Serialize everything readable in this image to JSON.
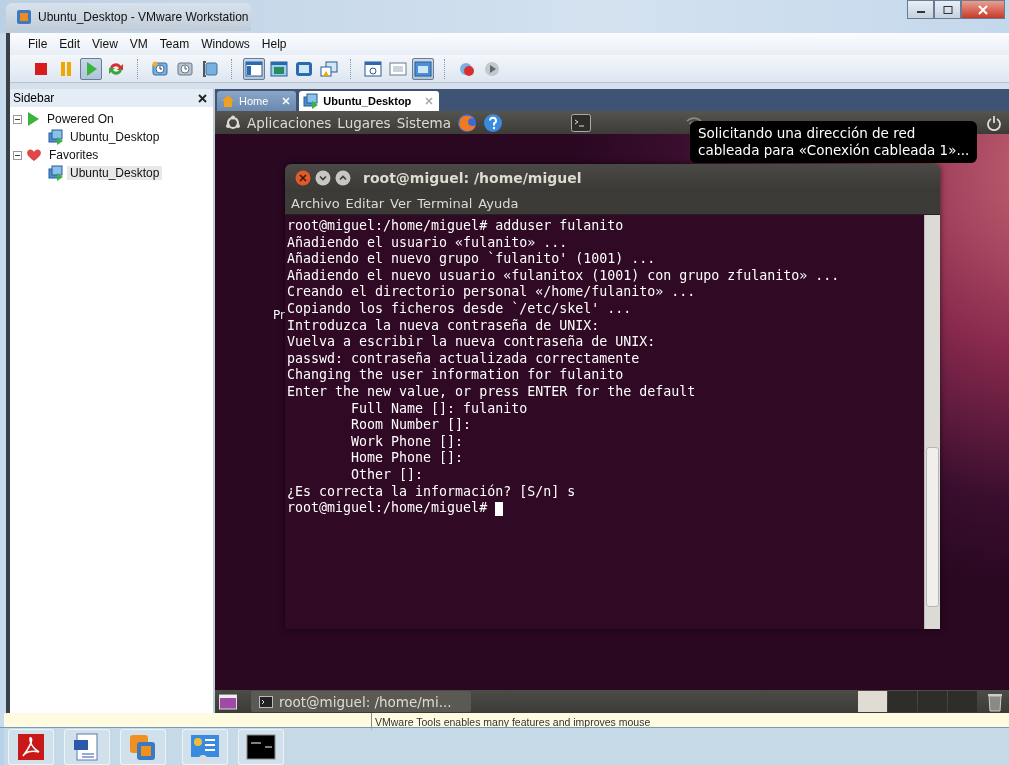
{
  "window": {
    "title": "Ubuntu_Desktop - VMware Workstation"
  },
  "menu": [
    "File",
    "Edit",
    "View",
    "VM",
    "Team",
    "Windows",
    "Help"
  ],
  "toolbar": [
    {
      "kind": "stop",
      "pressed": false
    },
    {
      "kind": "pause",
      "pressed": false
    },
    {
      "kind": "play",
      "pressed": true
    },
    {
      "kind": "reset",
      "pressed": false
    },
    {
      "kind": "separator"
    },
    {
      "kind": "snapshot",
      "pressed": false
    },
    {
      "kind": "revert",
      "pressed": false
    },
    {
      "kind": "manager",
      "pressed": false
    },
    {
      "kind": "separator"
    },
    {
      "kind": "sidebar",
      "pressed": true
    },
    {
      "kind": "fullscreen",
      "pressed": false
    },
    {
      "kind": "quickswitch",
      "pressed": false
    },
    {
      "kind": "unity",
      "pressed": false
    },
    {
      "kind": "separator"
    },
    {
      "kind": "console",
      "pressed": false
    },
    {
      "kind": "summary",
      "pressed": false
    },
    {
      "kind": "appliance",
      "pressed": true
    },
    {
      "kind": "separator"
    },
    {
      "kind": "record",
      "pressed": false
    },
    {
      "kind": "replay",
      "pressed": false
    }
  ],
  "sidebar": {
    "title": "Sidebar",
    "groups": [
      {
        "label": "Powered On",
        "kind": "powered",
        "expanded": true,
        "children": [
          {
            "label": "Ubuntu_Desktop",
            "selected": false
          }
        ]
      },
      {
        "label": "Favorites",
        "kind": "favorites",
        "expanded": true,
        "children": [
          {
            "label": "Ubuntu_Desktop",
            "selected": true
          }
        ]
      }
    ]
  },
  "tabs": [
    {
      "label": "Home",
      "kind": "home",
      "selected": false
    },
    {
      "label": "Ubuntu_Desktop",
      "kind": "vm",
      "selected": true
    }
  ],
  "guest": {
    "panel_menus": [
      "Aplicaciones",
      "Lugares",
      "Sistema"
    ],
    "tooltip_lines": [
      "Solicitando una dirección de red",
      "cableada para «Conexión cableada 1»..."
    ],
    "desktop_icon_label": "Pr",
    "terminal": {
      "title": "root@miguel: /home/miguel",
      "menu": [
        "Archivo",
        "Editar",
        "Ver",
        "Terminal",
        "Ayuda"
      ],
      "cursor": true,
      "lines": [
        "root@miguel:/home/miguel# adduser fulanito",
        "Añadiendo el usuario «fulanito» ...",
        "Añadiendo el nuevo grupo `fulanito' (1001) ...",
        "Añadiendo el nuevo usuario «fulanitox (1001) con grupo zfulanito» ...",
        "Creando el directorio personal «/home/fulanito» ...",
        "Copiando los ficheros desde `/etc/skel' ...",
        "Introduzca la nueva contraseña de UNIX:",
        "Vuelva a escribir la nueva contraseña de UNIX:",
        "passwd: contraseña actualizada correctamente",
        "Changing the user information for fulanito",
        "Enter the new value, or press ENTER for the default",
        "        Full Name []: fulanito",
        "        Room Number []:",
        "        Work Phone []:",
        "        Home Phone []:",
        "        Other []:",
        "¿Es correcta la información? [S/n] s",
        "root@miguel:/home/miguel# "
      ]
    },
    "taskbar_item": "root@miguel: /home/mi..."
  },
  "notification": "VMware Tools enables many features and improves mouse"
}
